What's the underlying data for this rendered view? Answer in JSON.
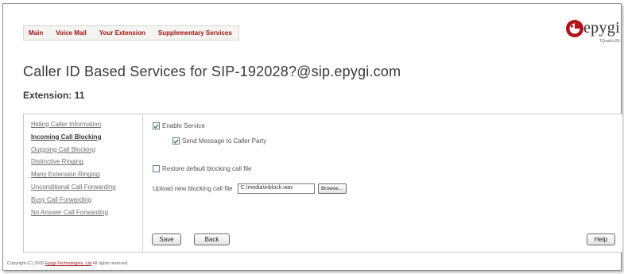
{
  "topnav": {
    "items": [
      "Main",
      "Voice Mail",
      "Your Extension",
      "Supplementary Services"
    ]
  },
  "logo": {
    "word": "epygi",
    "model": "TQuadro2E"
  },
  "page": {
    "title": "Caller ID Based Services for SIP-192028?@sip.epygi.com",
    "extension": "Extension: 11"
  },
  "sidebar": {
    "items": [
      {
        "label": "Hiding Caller Information"
      },
      {
        "label": "Incoming Call Blocking"
      },
      {
        "label": "Outgoing Call Blocking"
      },
      {
        "label": "Distinctive Ringing"
      },
      {
        "label": "Many Extension Ringing"
      },
      {
        "label": "Unconditional Call Forwarding"
      },
      {
        "label": "Busy Call Forwarding"
      },
      {
        "label": "No Answer Call Forwarding"
      }
    ]
  },
  "form": {
    "enable_service": {
      "label": "Enable Service",
      "checked": true
    },
    "send_message": {
      "label": "Send Message to Caller Party",
      "checked": true
    },
    "restore_default": {
      "label": "Restore default blocking call file",
      "checked": false
    },
    "upload": {
      "label": "Upload new blocking call file",
      "value": "C:\\media\\inblock.wav",
      "browse_label": "Browse..."
    }
  },
  "buttons": {
    "save": "Save",
    "back": "Back",
    "help": "Help"
  },
  "footer": {
    "prefix": "Copyright (C) 2005",
    "link": "Epygi Technologies, Ltd",
    "suffix": "All rights reserved."
  }
}
